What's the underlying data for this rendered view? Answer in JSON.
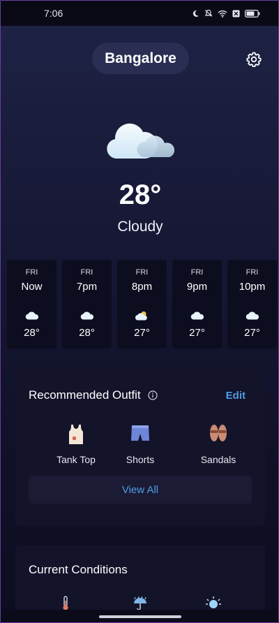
{
  "status_bar": {
    "time": "7:06",
    "icons": [
      "moon-icon",
      "bell-off-icon",
      "wifi-icon",
      "sim-x-icon",
      "battery-icon"
    ]
  },
  "header": {
    "city": "Bangalore",
    "settings_icon": "gear-icon"
  },
  "current": {
    "icon": "cloud-icon",
    "temperature": "28°",
    "condition": "Cloudy"
  },
  "hourly": [
    {
      "day": "FRI",
      "time": "Now",
      "icon": "cloud-icon",
      "temp": "28°"
    },
    {
      "day": "FRI",
      "time": "7pm",
      "icon": "cloud-icon",
      "temp": "28°"
    },
    {
      "day": "FRI",
      "time": "8pm",
      "icon": "partly-cloudy-icon",
      "temp": "27°"
    },
    {
      "day": "FRI",
      "time": "9pm",
      "icon": "cloud-icon",
      "temp": "27°"
    },
    {
      "day": "FRI",
      "time": "10pm",
      "icon": "cloud-icon",
      "temp": "27°"
    }
  ],
  "outfit": {
    "title": "Recommended Outfit",
    "edit_label": "Edit",
    "items": [
      {
        "label": "Tank Top",
        "icon": "tank-top-icon"
      },
      {
        "label": "Shorts",
        "icon": "shorts-icon"
      },
      {
        "label": "Sandals",
        "icon": "sandals-icon"
      }
    ],
    "view_all_label": "View All"
  },
  "conditions": {
    "title": "Current Conditions",
    "icons": [
      "thermometer-icon",
      "umbrella-rain-icon",
      "sun-icon"
    ]
  },
  "colors": {
    "accent": "#4f9de0",
    "background": "#151632",
    "card": "#13132a"
  }
}
